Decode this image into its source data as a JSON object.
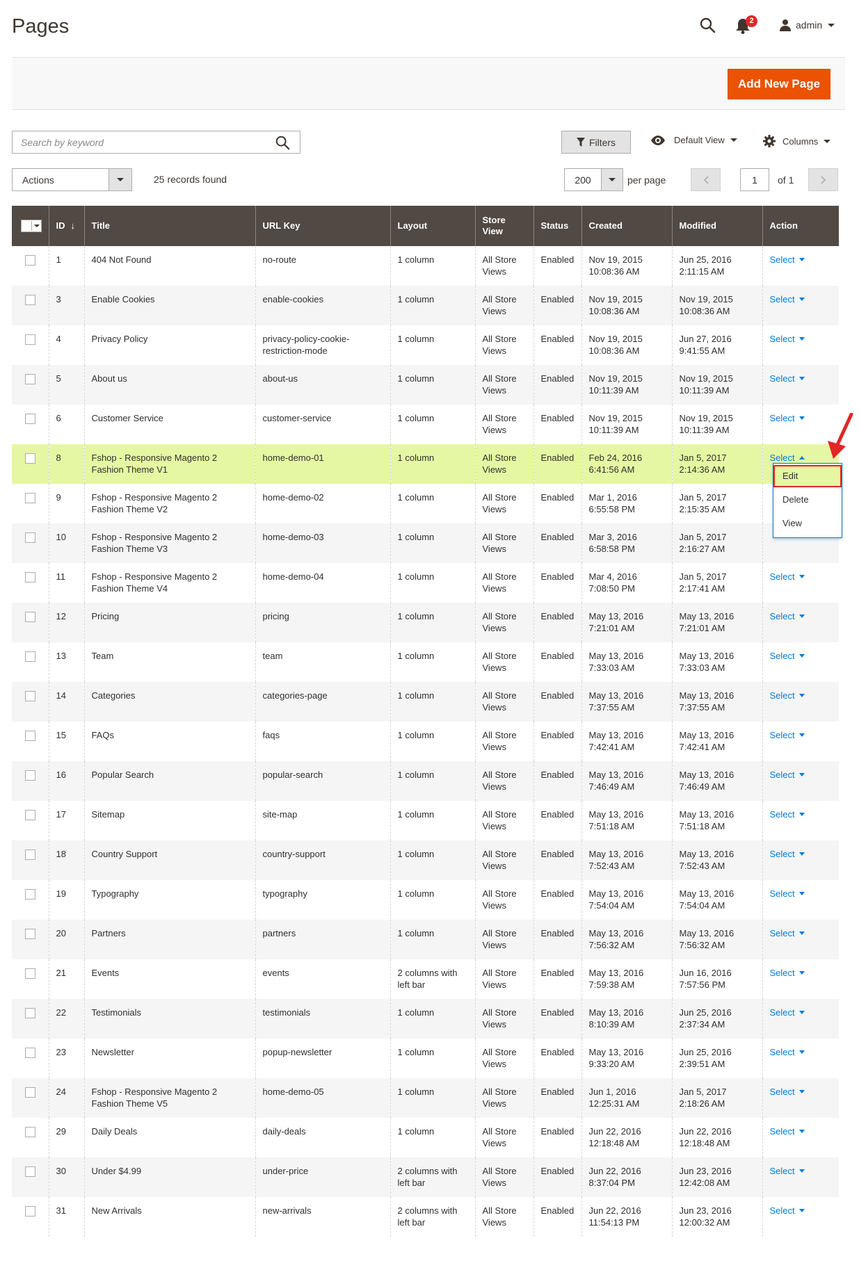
{
  "header": {
    "title": "Pages",
    "notification_count": "2",
    "user_name": "admin"
  },
  "actions_bar": {
    "add_new_label": "Add New Page"
  },
  "toolbar": {
    "search_placeholder": "Search by keyword",
    "filters_label": "Filters",
    "view_label": "Default View",
    "columns_label": "Columns",
    "mass_actions_label": "Actions",
    "records_found": "25 records found",
    "per_page_value": "200",
    "per_page_label": "per page",
    "current_page": "1",
    "total_pages_label": "of 1"
  },
  "grid": {
    "columns": [
      "ID",
      "Title",
      "URL Key",
      "Layout",
      "Store View",
      "Status",
      "Created",
      "Modified",
      "Action"
    ],
    "rows": [
      {
        "id": "1",
        "title": "404 Not Found",
        "url_key": "no-route",
        "layout": "1 column",
        "store": "All Store Views",
        "status": "Enabled",
        "created": "Nov 19, 2015 10:08:36 AM",
        "modified": "Jun 25, 2016 2:11:15 AM",
        "action": "Select"
      },
      {
        "id": "3",
        "title": "Enable Cookies",
        "url_key": "enable-cookies",
        "layout": "1 column",
        "store": "All Store Views",
        "status": "Enabled",
        "created": "Nov 19, 2015 10:08:36 AM",
        "modified": "Nov 19, 2015 10:08:36 AM",
        "action": "Select"
      },
      {
        "id": "4",
        "title": "Privacy Policy",
        "url_key": "privacy-policy-cookie-restriction-mode",
        "layout": "1 column",
        "store": "All Store Views",
        "status": "Enabled",
        "created": "Nov 19, 2015 10:08:36 AM",
        "modified": "Jun 27, 2016 9:41:55 AM",
        "action": "Select"
      },
      {
        "id": "5",
        "title": "About us",
        "url_key": "about-us",
        "layout": "1 column",
        "store": "All Store Views",
        "status": "Enabled",
        "created": "Nov 19, 2015 10:11:39 AM",
        "modified": "Nov 19, 2015 10:11:39 AM",
        "action": "Select"
      },
      {
        "id": "6",
        "title": "Customer Service",
        "url_key": "customer-service",
        "layout": "1 column",
        "store": "All Store Views",
        "status": "Enabled",
        "created": "Nov 19, 2015 10:11:39 AM",
        "modified": "Nov 19, 2015 10:11:39 AM",
        "action": "Select"
      },
      {
        "id": "8",
        "title": "Fshop - Responsive Magento 2 Fashion Theme V1",
        "url_key": "home-demo-01",
        "layout": "1 column",
        "store": "All Store Views",
        "status": "Enabled",
        "created": "Feb 24, 2016 6:41:56 AM",
        "modified": "Jan 5, 2017 2:14:36 AM",
        "action": "Select",
        "highlight": true
      },
      {
        "id": "9",
        "title": "Fshop - Responsive Magento 2 Fashion Theme V2",
        "url_key": "home-demo-02",
        "layout": "1 column",
        "store": "All Store Views",
        "status": "Enabled",
        "created": "Mar 1, 2016 6:55:58 PM",
        "modified": "Jan 5, 2017 2:15:35 AM",
        "action": ""
      },
      {
        "id": "10",
        "title": "Fshop - Responsive Magento 2 Fashion Theme V3",
        "url_key": "home-demo-03",
        "layout": "1 column",
        "store": "All Store Views",
        "status": "Enabled",
        "created": "Mar 3, 2016 6:58:58 PM",
        "modified": "Jan 5, 2017 2:16:27 AM",
        "action": ""
      },
      {
        "id": "11",
        "title": "Fshop - Responsive Magento 2 Fashion Theme V4",
        "url_key": "home-demo-04",
        "layout": "1 column",
        "store": "All Store Views",
        "status": "Enabled",
        "created": "Mar 4, 2016 7:08:50 PM",
        "modified": "Jan 5, 2017 2:17:41 AM",
        "action": "Select"
      },
      {
        "id": "12",
        "title": "Pricing",
        "url_key": "pricing",
        "layout": "1 column",
        "store": "All Store Views",
        "status": "Enabled",
        "created": "May 13, 2016 7:21:01 AM",
        "modified": "May 13, 2016 7:21:01 AM",
        "action": "Select"
      },
      {
        "id": "13",
        "title": "Team",
        "url_key": "team",
        "layout": "1 column",
        "store": "All Store Views",
        "status": "Enabled",
        "created": "May 13, 2016 7:33:03 AM",
        "modified": "May 13, 2016 7:33:03 AM",
        "action": "Select"
      },
      {
        "id": "14",
        "title": "Categories",
        "url_key": "categories-page",
        "layout": "1 column",
        "store": "All Store Views",
        "status": "Enabled",
        "created": "May 13, 2016 7:37:55 AM",
        "modified": "May 13, 2016 7:37:55 AM",
        "action": "Select"
      },
      {
        "id": "15",
        "title": "FAQs",
        "url_key": "faqs",
        "layout": "1 column",
        "store": "All Store Views",
        "status": "Enabled",
        "created": "May 13, 2016 7:42:41 AM",
        "modified": "May 13, 2016 7:42:41 AM",
        "action": "Select"
      },
      {
        "id": "16",
        "title": "Popular Search",
        "url_key": "popular-search",
        "layout": "1 column",
        "store": "All Store Views",
        "status": "Enabled",
        "created": "May 13, 2016 7:46:49 AM",
        "modified": "May 13, 2016 7:46:49 AM",
        "action": "Select"
      },
      {
        "id": "17",
        "title": "Sitemap",
        "url_key": "site-map",
        "layout": "1 column",
        "store": "All Store Views",
        "status": "Enabled",
        "created": "May 13, 2016 7:51:18 AM",
        "modified": "May 13, 2016 7:51:18 AM",
        "action": "Select"
      },
      {
        "id": "18",
        "title": "Country Support",
        "url_key": "country-support",
        "layout": "1 column",
        "store": "All Store Views",
        "status": "Enabled",
        "created": "May 13, 2016 7:52:43 AM",
        "modified": "May 13, 2016 7:52:43 AM",
        "action": "Select"
      },
      {
        "id": "19",
        "title": "Typography",
        "url_key": "typography",
        "layout": "1 column",
        "store": "All Store Views",
        "status": "Enabled",
        "created": "May 13, 2016 7:54:04 AM",
        "modified": "May 13, 2016 7:54:04 AM",
        "action": "Select"
      },
      {
        "id": "20",
        "title": "Partners",
        "url_key": "partners",
        "layout": "1 column",
        "store": "All Store Views",
        "status": "Enabled",
        "created": "May 13, 2016 7:56:32 AM",
        "modified": "May 13, 2016 7:56:32 AM",
        "action": "Select"
      },
      {
        "id": "21",
        "title": "Events",
        "url_key": "events",
        "layout": "2 columns with left bar",
        "store": "All Store Views",
        "status": "Enabled",
        "created": "May 13, 2016 7:59:38 AM",
        "modified": "Jun 16, 2016 7:57:56 PM",
        "action": "Select"
      },
      {
        "id": "22",
        "title": "Testimonials",
        "url_key": "testimonials",
        "layout": "1 column",
        "store": "All Store Views",
        "status": "Enabled",
        "created": "May 13, 2016 8:10:39 AM",
        "modified": "Jun 25, 2016 2:37:34 AM",
        "action": "Select"
      },
      {
        "id": "23",
        "title": "Newsletter",
        "url_key": "popup-newsletter",
        "layout": "1 column",
        "store": "All Store Views",
        "status": "Enabled",
        "created": "May 13, 2016 9:33:20 AM",
        "modified": "Jun 25, 2016 2:39:51 AM",
        "action": "Select"
      },
      {
        "id": "24",
        "title": "Fshop - Responsive Magento 2 Fashion Theme V5",
        "url_key": "home-demo-05",
        "layout": "1 column",
        "store": "All Store Views",
        "status": "Enabled",
        "created": "Jun 1, 2016 12:25:31 AM",
        "modified": "Jan 5, 2017 2:18:26 AM",
        "action": "Select"
      },
      {
        "id": "29",
        "title": "Daily Deals",
        "url_key": "daily-deals",
        "layout": "1 column",
        "store": "All Store Views",
        "status": "Enabled",
        "created": "Jun 22, 2016 12:18:48 AM",
        "modified": "Jun 22, 2016 12:18:48 AM",
        "action": "Select"
      },
      {
        "id": "30",
        "title": "Under $4.99",
        "url_key": "under-price",
        "layout": "2 columns with left bar",
        "store": "All Store Views",
        "status": "Enabled",
        "created": "Jun 22, 2016 8:37:04 PM",
        "modified": "Jun 23, 2016 12:42:08 AM",
        "action": "Select"
      },
      {
        "id": "31",
        "title": "New Arrivals",
        "url_key": "new-arrivals",
        "layout": "2 columns with left bar",
        "store": "All Store Views",
        "status": "Enabled",
        "created": "Jun 22, 2016 11:54:13 PM",
        "modified": "Jun 23, 2016 12:00:32 AM",
        "action": "Select"
      }
    ]
  },
  "action_menu": {
    "items": [
      "Edit",
      "Delete",
      "View"
    ]
  },
  "colors": {
    "accent": "#eb5202",
    "header_bg": "#514943",
    "link": "#007bdb",
    "highlight": "#e5f7a3",
    "callout": "#e22626"
  }
}
